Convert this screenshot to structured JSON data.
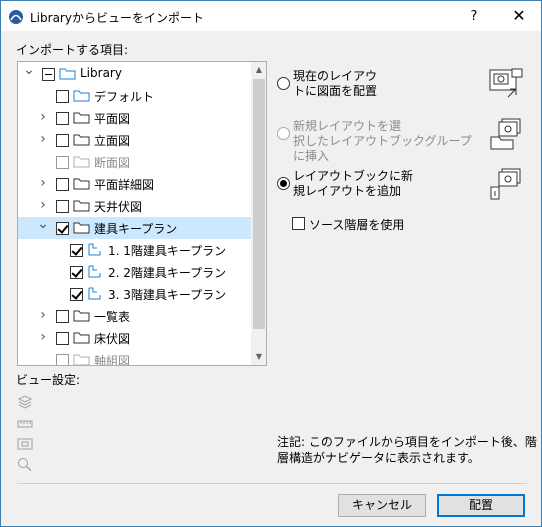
{
  "window": {
    "title": "Libraryからビューをインポート",
    "help_label": "?",
    "close_label": "✕"
  },
  "import_items_label": "インポートする項目:",
  "tree": {
    "items": [
      {
        "label": "Library",
        "expanded": true,
        "state": "partial",
        "icon": "library-folder-icon",
        "disabled": false
      },
      {
        "label": "デフォルト",
        "state": "unchecked",
        "icon": "view-folder-icon",
        "disabled": false
      },
      {
        "label": "平面図",
        "state": "unchecked",
        "icon": "folder-icon",
        "disabled": false
      },
      {
        "label": "立面図",
        "state": "unchecked",
        "icon": "folder-icon",
        "disabled": false
      },
      {
        "label": "断面図",
        "state": "unchecked",
        "icon": "folder-icon",
        "disabled": true
      },
      {
        "label": "平面詳細図",
        "state": "unchecked",
        "icon": "folder-icon",
        "disabled": false
      },
      {
        "label": "天井伏図",
        "state": "unchecked",
        "icon": "folder-icon",
        "disabled": false
      },
      {
        "label": "建具キープラン",
        "state": "checked",
        "icon": "folder-icon",
        "disabled": false,
        "selected": true
      },
      {
        "label": "1. 1階建具キープラン",
        "state": "checked",
        "icon": "view-icon",
        "disabled": false
      },
      {
        "label": "2. 2階建具キープラン",
        "state": "checked",
        "icon": "view-icon",
        "disabled": false
      },
      {
        "label": "3. 3階建具キープラン",
        "state": "checked",
        "icon": "view-icon",
        "disabled": false
      },
      {
        "label": "一覧表",
        "state": "unchecked",
        "icon": "folder-icon",
        "disabled": false
      },
      {
        "label": "床伏図",
        "state": "unchecked",
        "icon": "folder-icon",
        "disabled": false
      },
      {
        "label": "軸組図",
        "state": "unchecked",
        "icon": "folder-icon",
        "disabled": true
      }
    ]
  },
  "options": {
    "place_current": "現在のレイアウ\nトに図面を配置",
    "new_layout": "新規レイアウトを選\n択したレイアウトブックグループに挿入",
    "new_book": "レイアウトブックに新\n規レイアウトを追加",
    "use_source_layers": "ソース階層を使用",
    "selected": "new_book"
  },
  "view_settings_label": "ビュー設定:",
  "note": "注記: このファイルから項目をインポート後、階層構造がナビゲータに表示されます。",
  "buttons": {
    "cancel": "キャンセル",
    "place": "配置"
  },
  "colors": {
    "accent": "#0078d7",
    "selection": "#cce8ff",
    "folder_blue": "#1e7fd7"
  }
}
